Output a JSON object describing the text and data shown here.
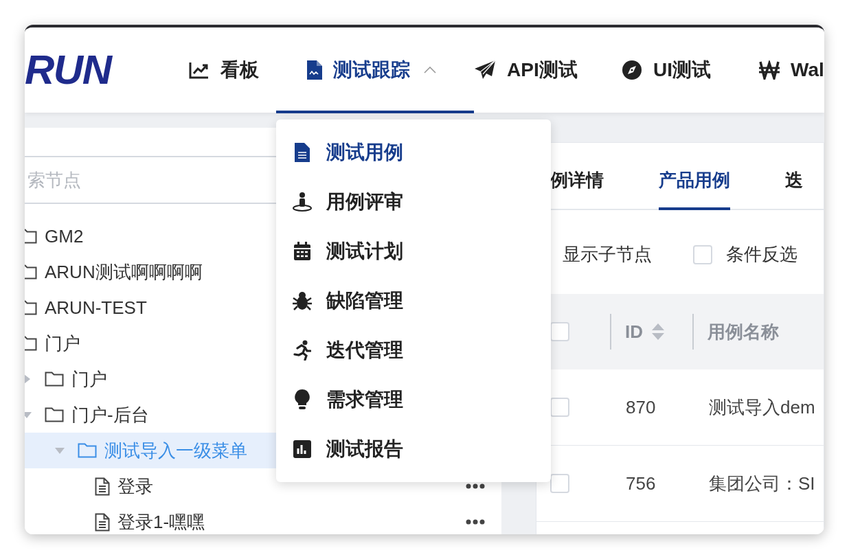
{
  "logo": {
    "text": "RUN"
  },
  "nav": [
    {
      "label": "看板",
      "selected": false
    },
    {
      "label": "测试跟踪",
      "selected": true,
      "expanded": true
    },
    {
      "label": "API测试",
      "selected": false
    },
    {
      "label": "UI测试",
      "selected": false
    },
    {
      "label": "Wal",
      "selected": false
    }
  ],
  "dropdown": [
    {
      "label": "测试用例",
      "selected": true
    },
    {
      "label": "用例评审",
      "selected": false
    },
    {
      "label": "测试计划",
      "selected": false
    },
    {
      "label": "缺陷管理",
      "selected": false
    },
    {
      "label": "迭代管理",
      "selected": false
    },
    {
      "label": "需求管理",
      "selected": false
    },
    {
      "label": "测试报告",
      "selected": false
    }
  ],
  "sidebar": {
    "search": {
      "placeholder": "索节点"
    },
    "tree": [
      {
        "kind": "folder",
        "label": "GM2",
        "selected": false
      },
      {
        "kind": "folder",
        "label": "ARUN测试啊啊啊啊",
        "selected": false
      },
      {
        "kind": "folder",
        "label": "ARUN-TEST",
        "selected": false
      },
      {
        "kind": "folder",
        "label": "门户",
        "selected": false,
        "children": [
          {
            "kind": "folder",
            "label": "门户",
            "selected": false,
            "expanded": false
          },
          {
            "kind": "folder",
            "label": "门户-后台",
            "selected": false,
            "expanded": true,
            "children": [
              {
                "kind": "folder",
                "label": "测试导入一级菜单",
                "selected": true,
                "expanded": true,
                "children": [
                  {
                    "kind": "file",
                    "label": "登录",
                    "selected": false,
                    "more": true
                  },
                  {
                    "kind": "file",
                    "label": "登录1-嘿嘿",
                    "selected": false,
                    "more": true
                  }
                ]
              }
            ]
          }
        ]
      }
    ]
  },
  "tabs": [
    {
      "label": "例详情",
      "selected": false
    },
    {
      "label": "产品用例",
      "selected": true
    },
    {
      "label": "迭",
      "selected": false
    }
  ],
  "filters": [
    {
      "label": "显示子节点"
    },
    {
      "label": "条件反选",
      "checked": false
    }
  ],
  "table": {
    "header_checked": false,
    "columns": [
      {
        "label": "ID",
        "sortable": true
      },
      {
        "label": "用例名称",
        "sortable": false
      }
    ],
    "rows": [
      {
        "checked": false,
        "cells": [
          "870",
          "测试导入dem"
        ]
      },
      {
        "checked": false,
        "cells": [
          "756",
          "集团公司：SI"
        ]
      }
    ]
  }
}
